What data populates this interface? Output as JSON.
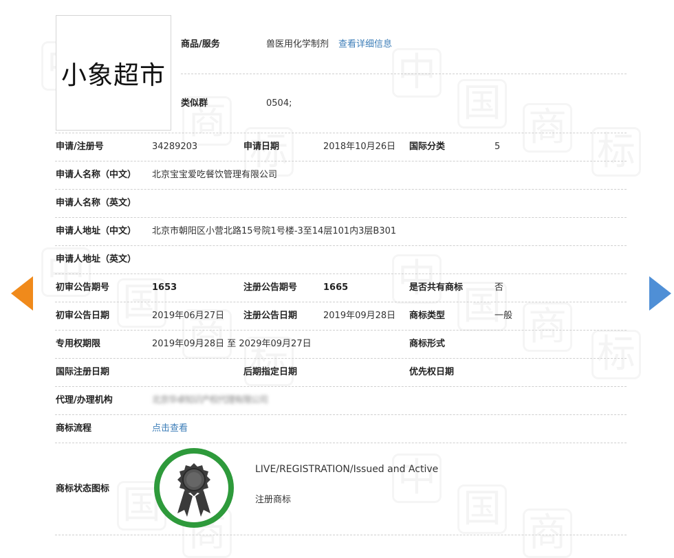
{
  "trademark": {
    "logo_text": "小象超市"
  },
  "goods": {
    "label": "商品/服务",
    "value": "兽医用化学制剂",
    "detail_link": "查看详细信息"
  },
  "similar_group": {
    "label": "类似群",
    "value": "0504;"
  },
  "rows": {
    "reg_no": {
      "label": "申请/注册号",
      "value": "34289203"
    },
    "apply_date": {
      "label": "申请日期",
      "value": "2018年10月26日"
    },
    "intl_class": {
      "label": "国际分类",
      "value": "5"
    },
    "applicant_cn": {
      "label": "申请人名称（中文）",
      "value": "北京宝宝爱吃餐饮管理有限公司"
    },
    "applicant_en": {
      "label": "申请人名称（英文）",
      "value": ""
    },
    "address_cn": {
      "label": "申请人地址（中文）",
      "value": "北京市朝阳区小营北路15号院1号楼-3至14层101内3层B301"
    },
    "address_en": {
      "label": "申请人地址（英文）",
      "value": ""
    },
    "prelim_no": {
      "label": "初审公告期号",
      "value": "1653"
    },
    "reg_pub_no": {
      "label": "注册公告期号",
      "value": "1665"
    },
    "shared": {
      "label": "是否共有商标",
      "value": "否"
    },
    "prelim_date": {
      "label": "初审公告日期",
      "value": "2019年06月27日"
    },
    "reg_pub_date": {
      "label": "注册公告日期",
      "value": "2019年09月28日"
    },
    "tm_type": {
      "label": "商标类型",
      "value": "一般"
    },
    "exclusive_period": {
      "label": "专用权期限",
      "value": "2019年09月28日 至 2029年09月27日"
    },
    "tm_form": {
      "label": "商标形式",
      "value": ""
    },
    "intl_reg_date": {
      "label": "国际注册日期",
      "value": ""
    },
    "later_date": {
      "label": "后期指定日期",
      "value": ""
    },
    "priority_date": {
      "label": "优先权日期",
      "value": ""
    },
    "agent": {
      "label": "代理/办理机构",
      "value": "北京华卓知识产权代理有限公司"
    },
    "process": {
      "label": "商标流程",
      "value": "点击查看"
    }
  },
  "status": {
    "label": "商标状态图标",
    "en": "LIVE/REGISTRATION/Issued and Active",
    "cn": "注册商标"
  },
  "colors": {
    "link": "#3d7eb8",
    "badge_ring": "#2e9a3b",
    "arrow_prev": "#f08a1b",
    "arrow_next": "#4f8fd6"
  }
}
